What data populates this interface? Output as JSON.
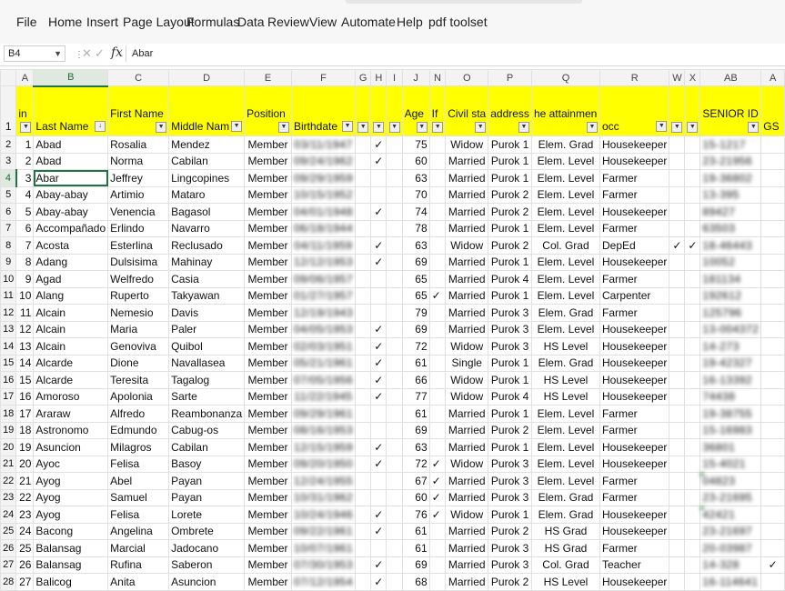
{
  "menu": [
    "File",
    "Home",
    "Insert",
    "Page Layout",
    "Formulas",
    "Data",
    "Review",
    "View",
    "Automate",
    "Help",
    "pdf toolset"
  ],
  "formula_bar": {
    "name_box": "B4",
    "content": "Abar"
  },
  "columns": [
    "A",
    "B",
    "C",
    "D",
    "E",
    "F",
    "G",
    "H",
    "I",
    "J",
    "N",
    "O",
    "P",
    "Q",
    "R",
    "W",
    "X",
    "AB",
    "A"
  ],
  "headers": [
    "in",
    "Last Name",
    "First Name",
    "Middle Nam",
    "Position",
    "Birthdate",
    "",
    "",
    "",
    "Age",
    "If",
    "Civil sta",
    "address",
    "he attainmen",
    "occ",
    "",
    "",
    "SENIOR ID",
    "GS"
  ],
  "rows": [
    {
      "n": "2",
      "id": "1",
      "last": "Abad",
      "first": "Rosalia",
      "middle": "Mendez",
      "pos": "Member",
      "bd": "03/11/1947",
      "g": "",
      "h": "✓",
      "age": "75",
      "if": "",
      "civil": "Widow",
      "addr": "Purok 1",
      "att": "Elem. Grad",
      "occ": "Housekeeper",
      "w": "",
      "x": "",
      "sid": "15-1217",
      "gs": ""
    },
    {
      "n": "3",
      "id": "2",
      "last": "Abad",
      "first": "Norma",
      "middle": "Cabilan",
      "pos": "Member",
      "bd": "09/24/1962",
      "g": "",
      "h": "✓",
      "age": "60",
      "if": "",
      "civil": "Married",
      "addr": "Purok 1",
      "att": "Elem. Level",
      "occ": "Housekeeper",
      "w": "",
      "x": "",
      "sid": "23-21956",
      "gs": ""
    },
    {
      "n": "4",
      "id": "3",
      "last": "Abar",
      "first": "Jeffrey",
      "middle": "Lingcopines",
      "pos": "Member",
      "bd": "09/29/1959",
      "g": "",
      "h": "",
      "age": "63",
      "if": "",
      "civil": "Married",
      "addr": "Purok 1",
      "att": "Elem. Level",
      "occ": "Farmer",
      "w": "",
      "x": "",
      "sid": "19-36802",
      "gs": ""
    },
    {
      "n": "5",
      "id": "4",
      "last": "Abay-abay",
      "first": "Artimio",
      "middle": "Mataro",
      "pos": "Member",
      "bd": "10/15/1952",
      "g": "",
      "h": "",
      "age": "70",
      "if": "",
      "civil": "Married",
      "addr": "Purok 2",
      "att": "Elem. Level",
      "occ": "Farmer",
      "w": "",
      "x": "",
      "sid": "13-395",
      "gs": ""
    },
    {
      "n": "6",
      "id": "5",
      "last": "Abay-abay",
      "first": "Venencia",
      "middle": "Bagasol",
      "pos": "Member",
      "bd": "04/01/1948",
      "g": "",
      "h": "✓",
      "age": "74",
      "if": "",
      "civil": "Married",
      "addr": "Purok 2",
      "att": "Elem. Level",
      "occ": "Housekeeper",
      "w": "",
      "x": "",
      "sid": "89427",
      "gs": ""
    },
    {
      "n": "7",
      "id": "6",
      "last": "Accompañado",
      "first": "Erlindo",
      "middle": "Navarro",
      "pos": "Member",
      "bd": "06/18/1944",
      "g": "",
      "h": "",
      "age": "78",
      "if": "",
      "civil": "Married",
      "addr": "Purok 1",
      "att": "Elem. Level",
      "occ": "Farmer",
      "w": "",
      "x": "",
      "sid": "63503",
      "gs": ""
    },
    {
      "n": "8",
      "id": "7",
      "last": "Acosta",
      "first": "Esterlina",
      "middle": "Reclusado",
      "pos": "Member",
      "bd": "04/11/1959",
      "g": "",
      "h": "✓",
      "age": "63",
      "if": "",
      "civil": "Widow",
      "addr": "Purok 2",
      "att": "Col. Grad",
      "occ": "DepEd",
      "w": "✓",
      "x": "✓",
      "sid": "18-46443",
      "gs": ""
    },
    {
      "n": "9",
      "id": "8",
      "last": "Adang",
      "first": "Dulsisima",
      "middle": "Mahinay",
      "pos": "Member",
      "bd": "12/12/1953",
      "g": "",
      "h": "✓",
      "age": "69",
      "if": "",
      "civil": "Married",
      "addr": "Purok 1",
      "att": "Elem. Level",
      "occ": "Housekeeper",
      "w": "",
      "x": "",
      "sid": "10052",
      "gs": ""
    },
    {
      "n": "10",
      "id": "9",
      "last": "Agad",
      "first": "Welfredo",
      "middle": "Casia",
      "pos": "Member",
      "bd": "09/06/1957",
      "g": "",
      "h": "",
      "age": "65",
      "if": "",
      "civil": "Married",
      "addr": "Purok 4",
      "att": "Elem. Level",
      "occ": "Farmer",
      "w": "",
      "x": "",
      "sid": "181134",
      "gs": ""
    },
    {
      "n": "11",
      "id": "10",
      "last": "Alang",
      "first": "Ruperto",
      "middle": "Takyawan",
      "pos": "Member",
      "bd": "01/27/1957",
      "g": "",
      "h": "",
      "age": "65",
      "if": "✓",
      "civil": "Married",
      "addr": "Purok 1",
      "att": "Elem. Level",
      "occ": "Carpenter",
      "w": "",
      "x": "",
      "sid": "192612",
      "gs": ""
    },
    {
      "n": "12",
      "id": "11",
      "last": "Alcain",
      "first": "Nemesio",
      "middle": "Davis",
      "pos": "Member",
      "bd": "12/19/1943",
      "g": "",
      "h": "",
      "age": "79",
      "if": "",
      "civil": "Married",
      "addr": "Purok 3",
      "att": "Elem. Grad",
      "occ": "Farmer",
      "w": "",
      "x": "",
      "sid": "125796",
      "gs": ""
    },
    {
      "n": "13",
      "id": "12",
      "last": "Alcain",
      "first": "Maria",
      "middle": "Paler",
      "pos": "Member",
      "bd": "04/05/1953",
      "g": "",
      "h": "✓",
      "age": "69",
      "if": "",
      "civil": "Married",
      "addr": "Purok 3",
      "att": "Elem. Level",
      "occ": "Housekeeper",
      "w": "",
      "x": "",
      "sid": "13-004372",
      "gs": ""
    },
    {
      "n": "14",
      "id": "13",
      "last": "Alcain",
      "first": "Genoviva",
      "middle": "Quibol",
      "pos": "Member",
      "bd": "02/03/1951",
      "g": "",
      "h": "✓",
      "age": "72",
      "if": "",
      "civil": "Widow",
      "addr": "Purok 3",
      "att": "HS Level",
      "occ": "Housekeeper",
      "w": "",
      "x": "",
      "sid": "14-273",
      "gs": ""
    },
    {
      "n": "15",
      "id": "14",
      "last": "Alcarde",
      "first": "Dione",
      "middle": "Navallasea",
      "pos": "Member",
      "bd": "05/21/1961",
      "g": "",
      "h": "✓",
      "age": "61",
      "if": "",
      "civil": "Single",
      "addr": "Purok 1",
      "att": "Elem. Grad",
      "occ": "Housekeeper",
      "w": "",
      "x": "",
      "sid": "19-42327",
      "gs": ""
    },
    {
      "n": "16",
      "id": "15",
      "last": "Alcarde",
      "first": "Teresita",
      "middle": "Tagalog",
      "pos": "Member",
      "bd": "07/05/1956",
      "g": "",
      "h": "✓",
      "age": "66",
      "if": "",
      "civil": "Widow",
      "addr": "Purok 1",
      "att": "HS Level",
      "occ": "Housekeeper",
      "w": "",
      "x": "",
      "sid": "16-13392",
      "gs": ""
    },
    {
      "n": "17",
      "id": "16",
      "last": "Amoroso",
      "first": "Apolonia",
      "middle": "Sarte",
      "pos": "Member",
      "bd": "11/22/1945",
      "g": "",
      "h": "✓",
      "age": "77",
      "if": "",
      "civil": "Widow",
      "addr": "Purok 4",
      "att": "HS Level",
      "occ": "Housekeeper",
      "w": "",
      "x": "",
      "sid": "74438",
      "gs": ""
    },
    {
      "n": "18",
      "id": "17",
      "last": "Araraw",
      "first": "Alfredo",
      "middle": "Reambonanza",
      "pos": "Member",
      "bd": "09/29/1961",
      "g": "",
      "h": "",
      "age": "61",
      "if": "",
      "civil": "Married",
      "addr": "Purok 1",
      "att": "Elem. Level",
      "occ": "Farmer",
      "w": "",
      "x": "",
      "sid": "19-38755",
      "gs": ""
    },
    {
      "n": "19",
      "id": "18",
      "last": "Astronomo",
      "first": "Edmundo",
      "middle": "Cabug-os",
      "pos": "Member",
      "bd": "08/16/1953",
      "g": "",
      "h": "",
      "age": "69",
      "if": "",
      "civil": "Married",
      "addr": "Purok 2",
      "att": "Elem. Level",
      "occ": "Farmer",
      "w": "",
      "x": "",
      "sid": "15-16983",
      "gs": ""
    },
    {
      "n": "20",
      "id": "19",
      "last": "Asuncion",
      "first": "Milagros",
      "middle": "Cabilan",
      "pos": "Member",
      "bd": "12/15/1959",
      "g": "",
      "h": "✓",
      "age": "63",
      "if": "",
      "civil": "Married",
      "addr": "Purok 1",
      "att": "Elem. Level",
      "occ": "Housekeeper",
      "w": "",
      "x": "",
      "sid": "36801",
      "gs": ""
    },
    {
      "n": "21",
      "id": "20",
      "last": "Ayoc",
      "first": "Felisa",
      "middle": "Basoy",
      "pos": "Member",
      "bd": "09/20/1950",
      "g": "",
      "h": "✓",
      "age": "72",
      "if": "✓",
      "civil": "Widow",
      "addr": "Purok 3",
      "att": "Elem. Level",
      "occ": "Housekeeper",
      "w": "",
      "x": "",
      "sid": "15-4021",
      "gs": ""
    },
    {
      "n": "22",
      "id": "21",
      "last": "Ayog",
      "first": "Abel",
      "middle": "Payan",
      "pos": "Member",
      "bd": "12/24/1955",
      "g": "",
      "h": "",
      "age": "67",
      "if": "✓",
      "civil": "Married",
      "addr": "Purok 3",
      "att": "Elem. Level",
      "occ": "Farmer",
      "w": "",
      "x": "",
      "sid": "04823",
      "gs": "",
      "mark": true
    },
    {
      "n": "23",
      "id": "22",
      "last": "Ayog",
      "first": "Samuel",
      "middle": "Payan",
      "pos": "Member",
      "bd": "10/31/1962",
      "g": "",
      "h": "",
      "age": "60",
      "if": "✓",
      "civil": "Married",
      "addr": "Purok 3",
      "att": "Elem. Grad",
      "occ": "Farmer",
      "w": "",
      "x": "",
      "sid": "23-21695",
      "gs": ""
    },
    {
      "n": "24",
      "id": "23",
      "last": "Ayog",
      "first": "Felisa",
      "middle": "Lorete",
      "pos": "Member",
      "bd": "10/24/1946",
      "g": "",
      "h": "✓",
      "age": "76",
      "if": "✓",
      "civil": "Widow",
      "addr": "Purok 1",
      "att": "Elem. Grad",
      "occ": "Housekeeper",
      "w": "",
      "x": "",
      "sid": "42421",
      "gs": "",
      "mark": true
    },
    {
      "n": "25",
      "id": "24",
      "last": "Bacong",
      "first": "Angelina",
      "middle": "Ombrete",
      "pos": "Member",
      "bd": "09/22/1961",
      "g": "",
      "h": "✓",
      "age": "61",
      "if": "",
      "civil": "Married",
      "addr": "Purok 2",
      "att": "HS Grad",
      "occ": "Housekeeper",
      "w": "",
      "x": "",
      "sid": "23-21697",
      "gs": ""
    },
    {
      "n": "26",
      "id": "25",
      "last": "Balansag",
      "first": "Marcial",
      "middle": "Jadocano",
      "pos": "Member",
      "bd": "10/07/1961",
      "g": "",
      "h": "",
      "age": "61",
      "if": "",
      "civil": "Married",
      "addr": "Purok 3",
      "att": "HS Grad",
      "occ": "Farmer",
      "w": "",
      "x": "",
      "sid": "20-03987",
      "gs": ""
    },
    {
      "n": "27",
      "id": "26",
      "last": "Balansag",
      "first": "Rufina",
      "middle": "Saberon",
      "pos": "Member",
      "bd": "07/30/1953",
      "g": "",
      "h": "✓",
      "age": "69",
      "if": "",
      "civil": "Married",
      "addr": "Purok 3",
      "att": "Col. Grad",
      "occ": "Teacher",
      "w": "",
      "x": "",
      "sid": "14-328",
      "gs": "✓"
    },
    {
      "n": "28",
      "id": "27",
      "last": "Balicog",
      "first": "Anita",
      "middle": "Asuncion",
      "pos": "Member",
      "bd": "07/12/1954",
      "g": "",
      "h": "✓",
      "age": "68",
      "if": "",
      "civil": "Married",
      "addr": "Purok 2",
      "att": "HS Level",
      "occ": "Housekeeper",
      "w": "",
      "x": "",
      "sid": "16-114641",
      "gs": ""
    }
  ]
}
